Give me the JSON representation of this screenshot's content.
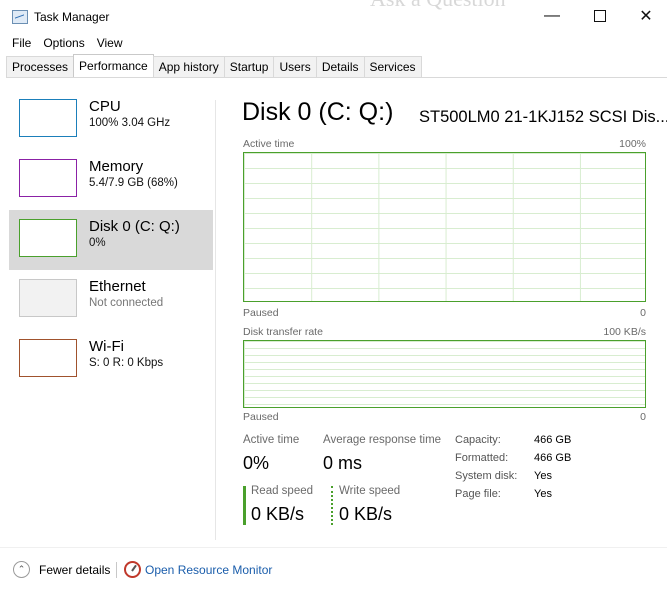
{
  "window": {
    "title": "Task Manager",
    "ghost_text": "Ask a Question"
  },
  "menu": [
    "File",
    "Options",
    "View"
  ],
  "tabs": [
    "Processes",
    "Performance",
    "App history",
    "Startup",
    "Users",
    "Details",
    "Services"
  ],
  "active_tab": "Performance",
  "sidebar": {
    "items": [
      {
        "title": "CPU",
        "subtitle": "100% 3.04 GHz",
        "color": "#1b7fba"
      },
      {
        "title": "Memory",
        "subtitle": "5.4/7.9 GB (68%)",
        "color": "#8b21a6"
      },
      {
        "title": "Disk 0 (C: Q:)",
        "subtitle": "0%",
        "color": "#4aa02c",
        "selected": true
      },
      {
        "title": "Ethernet",
        "subtitle": "Not connected",
        "color": "#c8c8c8"
      },
      {
        "title": "Wi-Fi",
        "subtitle": "S: 0 R: 0 Kbps",
        "color": "#a0522d"
      }
    ]
  },
  "main": {
    "title": "Disk 0 (C: Q:)",
    "device": "ST500LM0 21-1KJ152 SCSI Dis...",
    "graph1": {
      "label": "Active time",
      "max": "100%",
      "status": "Paused",
      "min": "0"
    },
    "graph2": {
      "label": "Disk transfer rate",
      "max": "100 KB/s",
      "status": "Paused",
      "min": "0"
    },
    "stats": {
      "active_time_label": "Active time",
      "active_time_value": "0%",
      "avg_response_label": "Average response time",
      "avg_response_value": "0 ms",
      "read_speed_label": "Read speed",
      "read_speed_value": "0 KB/s",
      "write_speed_label": "Write speed",
      "write_speed_value": "0 KB/s"
    },
    "details": [
      {
        "key": "Capacity:",
        "value": "466 GB"
      },
      {
        "key": "Formatted:",
        "value": "466 GB"
      },
      {
        "key": "System disk:",
        "value": "Yes"
      },
      {
        "key": "Page file:",
        "value": "Yes"
      }
    ]
  },
  "footer": {
    "fewer_details": "Fewer details",
    "open_resource_monitor": "Open Resource Monitor"
  }
}
